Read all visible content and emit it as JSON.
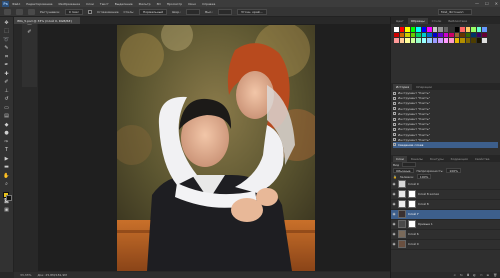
{
  "app": {
    "logo": "Ps",
    "menu": [
      "Файл",
      "Редактирование",
      "Изображение",
      "Слои",
      "Текст",
      "Выделение",
      "Фильтр",
      "3D",
      "Просмотр",
      "Окно",
      "Справка"
    ],
    "window_controls": [
      "—",
      "☐",
      "✕"
    ]
  },
  "options": {
    "feather_label": "Растушевка:",
    "feather_value": "0 пикс",
    "smooth_label": "Сглаживание",
    "style_label": "Стиль:",
    "style_value": "Нормальный",
    "width_label": "Шир.:",
    "height_label": "Выс.:",
    "refine_label": "Уточн. край...",
    "workspace": "Мой_Фотошоп"
  },
  "document": {
    "tab_title": "IMG_5.psd @ 33% (Слой 0, RGB/8#)",
    "zoom": "33,33%",
    "doc_info": "Док: 25,8M/181,9M"
  },
  "panels": {
    "top_tabs": [
      "Цвет",
      "Образцы",
      "Стили",
      "Библиотеки"
    ],
    "top_active": 1,
    "swatch_colors": [
      "#ffffff",
      "#ff0000",
      "#ffff00",
      "#00ff00",
      "#00ffff",
      "#0000ff",
      "#ff00ff",
      "#c8c8c8",
      "#969696",
      "#646464",
      "#323232",
      "#000000",
      "#ff6666",
      "#ffcc66",
      "#99ff66",
      "#66ffcc",
      "#6699ff",
      "#cc0000",
      "#cc6600",
      "#cccc00",
      "#66cc00",
      "#00cc66",
      "#00cccc",
      "#0066cc",
      "#0000cc",
      "#6600cc",
      "#cc00cc",
      "#cc0066",
      "#996633",
      "#663300",
      "#336600",
      "#003366",
      "#330066",
      "#660033",
      "#ff9999",
      "#ffcc99",
      "#ffff99",
      "#ccff99",
      "#99ffcc",
      "#99ffff",
      "#99ccff",
      "#9999ff",
      "#cc99ff",
      "#ff99ff",
      "#ff99cc",
      "#e6b800",
      "#b38f00",
      "#806600",
      "#4d3d00",
      "#1a1400",
      "#e0e0e0"
    ],
    "history_tabs": [
      "История",
      "Операции"
    ],
    "history_active": 0,
    "history_items": [
      "Инструмент \"Кисть\"",
      "Инструмент \"Кисть\"",
      "Инструмент \"Кисть\"",
      "Инструмент \"Кисть\"",
      "Инструмент \"Кисть\"",
      "Инструмент \"Кисть\"",
      "Инструмент \"Кисть\"",
      "Инструмент \"Кисть\"",
      "Инструмент \"Кисть\"",
      "Инструмент \"Кисть\"",
      "Сведение слоев"
    ],
    "history_current_index": 10,
    "layer_tabs": [
      "Слои",
      "Каналы",
      "Контуры",
      "Коррекция",
      "Свойства"
    ],
    "layer_active": 0,
    "kind_label": "Вид",
    "blend_mode": "Обычные",
    "opacity_label": "Непрозрачность:",
    "opacity_value": "100%",
    "fill_label": "Заливка:",
    "fill_value": "100%",
    "layers": [
      {
        "name": "Слой 9",
        "thumb": "#d8d8d8",
        "mask": false
      },
      {
        "name": "Слой 8 копия",
        "thumb": "#e8e8e8",
        "mask": true
      },
      {
        "name": "Слой 8",
        "thumb": "#eeeeee",
        "mask": true
      },
      {
        "name": "Слой 7",
        "thumb": "#3a3030",
        "mask": false
      },
      {
        "name": "Кривые 1",
        "thumb": "#4a4a4a",
        "mask": true
      },
      {
        "name": "Слой 6",
        "thumb": "#7a6a5a",
        "mask": false
      },
      {
        "name": "Слой 0",
        "thumb": "#6a5040",
        "mask": false
      }
    ],
    "selected_layer_index": 3
  }
}
